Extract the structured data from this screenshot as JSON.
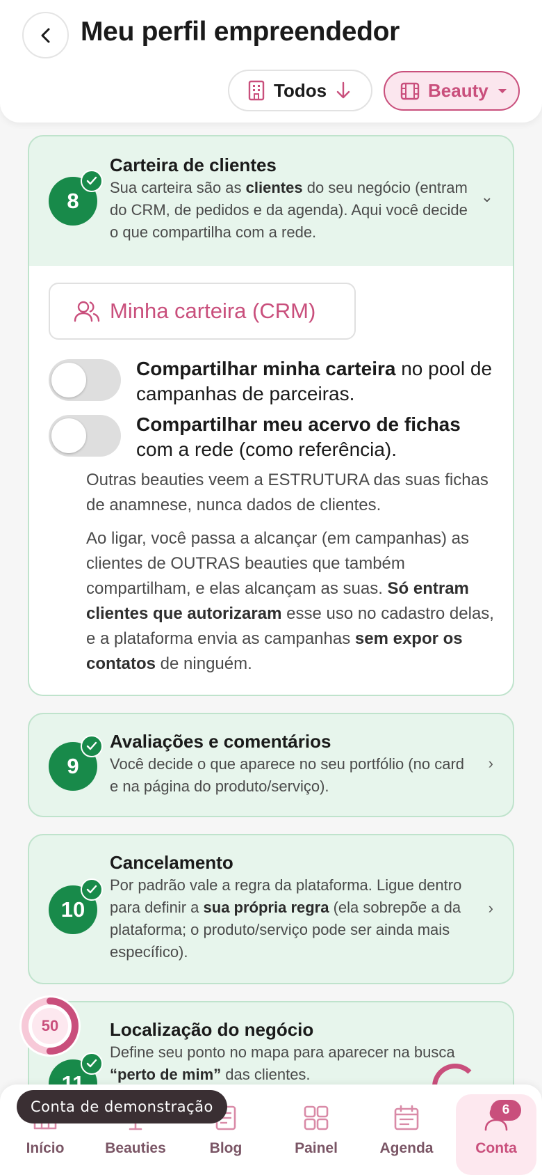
{
  "header": {
    "title": "Meu perfil empreendedor",
    "filter_all": "Todos",
    "filter_segment": "Beauty"
  },
  "sections": [
    {
      "number": "8",
      "title": "Carteira de clientes",
      "desc_parts": [
        "Sua carteira são as ",
        "clientes",
        " do seu negócio (entram do CRM, de pedidos e da agenda). Aqui você decide o que compartilha com a rede."
      ],
      "expanded": true
    },
    {
      "number": "9",
      "title": "Avaliações e comentários",
      "desc": "Você decide o que aparece no seu portfólio (no card e na página do produto/serviço)."
    },
    {
      "number": "10",
      "title": "Cancelamento",
      "desc_parts": [
        "Por padrão vale a regra da plataforma. Ligue dentro para definir a ",
        "sua própria regra",
        " (ela sobrepõe a da plataforma; o produto/serviço pode ser ainda mais específico)."
      ]
    },
    {
      "number": "11",
      "title": "Localização do negócio",
      "desc_parts": [
        "Define seu ponto no mapa para aparecer na busca ",
        "“perto de mim”",
        " das clientes."
      ]
    }
  ],
  "crm": {
    "button_label": "Minha carteira (CRM)",
    "toggle1_bold": "Compartilhar minha carteira",
    "toggle1_rest": " no pool de campanhas de parceiras.",
    "toggle1_on": false,
    "toggle2_bold": "Compartilhar meu acervo de fichas",
    "toggle2_rest": " com a rede (como referência).",
    "toggle2_on": false,
    "note1": "Outras beauties veem a ESTRUTURA das suas fichas de anamnese, nunca dados de clientes.",
    "note2_parts": [
      "Ao ligar, você passa a alcançar (em campanhas) as clientes de OUTRAS beauties que também compartilham, e elas alcançam as suas. ",
      "Só entram clientes que autorizaram",
      " esse uso no cadastro delas, e a plataforma envia as campanhas ",
      "sem expor os contatos",
      " de ninguém."
    ]
  },
  "progress": {
    "value": "50",
    "percent": 50
  },
  "toast": "Conta de demonstração",
  "nav": {
    "items": [
      {
        "label": "Início",
        "icon": "home-icon"
      },
      {
        "label": "Beauties",
        "icon": "beauty-icon"
      },
      {
        "label": "Blog",
        "icon": "blog-icon"
      },
      {
        "label": "Painel",
        "icon": "grid-icon"
      },
      {
        "label": "Agenda",
        "icon": "calendar-icon"
      },
      {
        "label": "Conta",
        "icon": "user-icon",
        "badge": "6",
        "active": true
      }
    ]
  },
  "colors": {
    "brand": "#c94f7c",
    "success": "#188a4a",
    "card_bg": "#e7f5ec",
    "card_border": "#bfe3cc"
  }
}
